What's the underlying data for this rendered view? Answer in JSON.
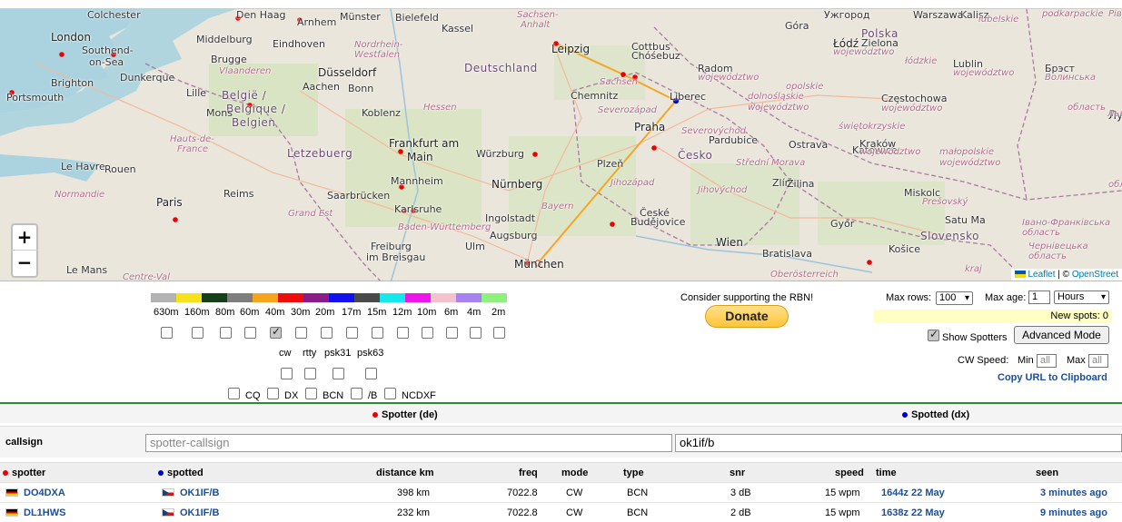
{
  "map": {
    "zoom_in": "+",
    "zoom_out": "−",
    "attribution": {
      "leaflet": "Leaflet",
      "sep": " | © ",
      "osm": "OpenStreet"
    },
    "labels": [
      {
        "t": "Colchester",
        "c": ""
      },
      {
        "t": "London",
        "c": "city-big"
      },
      {
        "t": "Southend-",
        "c": ""
      },
      {
        "t": "on-Sea",
        "c": ""
      },
      {
        "t": "Brighton",
        "c": ""
      },
      {
        "t": "Portsmouth",
        "c": ""
      },
      {
        "t": "Dunkerque",
        "c": ""
      },
      {
        "t": "Middelburg",
        "c": ""
      },
      {
        "t": "Brugge",
        "c": ""
      },
      {
        "t": "Vlaanderen",
        "c": "region"
      },
      {
        "t": "Den Haag",
        "c": ""
      },
      {
        "t": "Arnhem",
        "c": ""
      },
      {
        "t": "Eindhoven",
        "c": ""
      },
      {
        "t": "Münster",
        "c": ""
      },
      {
        "t": "Bielefeld",
        "c": ""
      },
      {
        "t": "Nordrhein-",
        "c": "region"
      },
      {
        "t": "Westfalen",
        "c": "region"
      },
      {
        "t": "Düsseldorf",
        "c": "city-big"
      },
      {
        "t": "Lille",
        "c": ""
      },
      {
        "t": "België /",
        "c": "country"
      },
      {
        "t": "Belgique /",
        "c": "country"
      },
      {
        "t": "Belgien",
        "c": "country"
      },
      {
        "t": "Aachen",
        "c": ""
      },
      {
        "t": "Bonn",
        "c": ""
      },
      {
        "t": "Mons",
        "c": ""
      },
      {
        "t": "Koblenz",
        "c": ""
      },
      {
        "t": "Kassel",
        "c": ""
      },
      {
        "t": "Deutschland",
        "c": "country"
      },
      {
        "t": "Hessen",
        "c": "region"
      },
      {
        "t": "Frankfurt am",
        "c": "city-big"
      },
      {
        "t": "Main",
        "c": "city-big"
      },
      {
        "t": "Hauts-de-",
        "c": "region"
      },
      {
        "t": "France",
        "c": "region"
      },
      {
        "t": "Letzebuerg",
        "c": "country"
      },
      {
        "t": "Le Havre",
        "c": ""
      },
      {
        "t": "Rouen",
        "c": ""
      },
      {
        "t": "Reims",
        "c": ""
      },
      {
        "t": "Normandie",
        "c": "region"
      },
      {
        "t": "Paris",
        "c": "city-big"
      },
      {
        "t": "Saarbrücken",
        "c": ""
      },
      {
        "t": "Mannheim",
        "c": ""
      },
      {
        "t": "Karlsruhe",
        "c": ""
      },
      {
        "t": "Grand Est",
        "c": "region"
      },
      {
        "t": "Baden-Württemberg",
        "c": "region"
      },
      {
        "t": "Würzburg",
        "c": ""
      },
      {
        "t": "Nürnberg",
        "c": "city-big"
      },
      {
        "t": "Ingolstadt",
        "c": ""
      },
      {
        "t": "Bayern",
        "c": "region"
      },
      {
        "t": "Augsburg",
        "c": ""
      },
      {
        "t": "Ulm",
        "c": ""
      },
      {
        "t": "Freiburg",
        "c": ""
      },
      {
        "t": "im Breisgau",
        "c": ""
      },
      {
        "t": "München",
        "c": "city-big"
      },
      {
        "t": "Le Mans",
        "c": ""
      },
      {
        "t": "Centre-Val",
        "c": "region"
      },
      {
        "t": "Leipzig",
        "c": "city-big"
      },
      {
        "t": "Sachsen-",
        "c": "region"
      },
      {
        "t": "Anhalt",
        "c": "region"
      },
      {
        "t": "Sachsen",
        "c": "region"
      },
      {
        "t": "Chemnitz",
        "c": ""
      },
      {
        "t": "Cottbus",
        "c": ""
      },
      {
        "t": "Chóśebuz",
        "c": ""
      },
      {
        "t": "Liberec",
        "c": ""
      },
      {
        "t": "Severozápad",
        "c": "region"
      },
      {
        "t": "Praha",
        "c": "city-big"
      },
      {
        "t": "Severovýchod",
        "c": "region"
      },
      {
        "t": "Plzeň",
        "c": ""
      },
      {
        "t": "Jihozápad",
        "c": "region"
      },
      {
        "t": "České",
        "c": ""
      },
      {
        "t": "Budějovice",
        "c": ""
      },
      {
        "t": "Pardubice",
        "c": ""
      },
      {
        "t": "Česko",
        "c": "country"
      },
      {
        "t": "Jihovýchod",
        "c": "region"
      },
      {
        "t": "Střední Morava",
        "c": "region"
      },
      {
        "t": "Ostrava",
        "c": ""
      },
      {
        "t": "Zlín",
        "c": ""
      },
      {
        "t": "Žilina",
        "c": ""
      },
      {
        "t": "Wien",
        "c": "city-big"
      },
      {
        "t": "Bratislava",
        "c": ""
      },
      {
        "t": "Oberösterreich",
        "c": "region"
      },
      {
        "t": "Győr",
        "c": ""
      },
      {
        "t": "Slovensko",
        "c": "country"
      },
      {
        "t": "Košice",
        "c": ""
      },
      {
        "t": "Miskolc",
        "c": ""
      },
      {
        "t": "Prešovský",
        "c": "region"
      },
      {
        "t": "kraj",
        "c": "region"
      },
      {
        "t": "Satu Ma",
        "c": ""
      },
      {
        "t": "Ужгород",
        "c": ""
      },
      {
        "t": "Polska",
        "c": "country"
      },
      {
        "t": "Zielona",
        "c": ""
      },
      {
        "t": "Góra",
        "c": ""
      },
      {
        "t": "Kalisz",
        "c": ""
      },
      {
        "t": "Łódź",
        "c": "city-big"
      },
      {
        "t": "województwo",
        "c": "region"
      },
      {
        "t": "łódzkie",
        "c": "region"
      },
      {
        "t": "Radom",
        "c": ""
      },
      {
        "t": "województwo",
        "c": "region"
      },
      {
        "t": "dolnośląskie",
        "c": "region"
      },
      {
        "t": "województwo",
        "c": "region"
      },
      {
        "t": "opolskie",
        "c": "region"
      },
      {
        "t": "Częstochowa",
        "c": ""
      },
      {
        "t": "województwo",
        "c": "region"
      },
      {
        "t": "świętokrzyskie",
        "c": "region"
      },
      {
        "t": "Katowice",
        "c": ""
      },
      {
        "t": "Kraków",
        "c": ""
      },
      {
        "t": "województwo",
        "c": "region"
      },
      {
        "t": "małopolskie",
        "c": "region"
      },
      {
        "t": "województwo",
        "c": "region"
      },
      {
        "t": "podkarpackie",
        "c": "region"
      },
      {
        "t": "Lublin",
        "c": ""
      },
      {
        "t": "województwo",
        "c": "region"
      },
      {
        "t": "lubelskie",
        "c": "region"
      },
      {
        "t": "Брэст",
        "c": ""
      },
      {
        "t": "Волинська",
        "c": "region"
      },
      {
        "t": "область",
        "c": "region"
      },
      {
        "t": "Луцьк",
        "c": "city-big"
      },
      {
        "t": "Рівне",
        "c": "region"
      },
      {
        "t": "Львівська",
        "c": "region"
      },
      {
        "t": "область",
        "c": "region"
      },
      {
        "t": "Івано-Франківська",
        "c": "region"
      },
      {
        "t": "область",
        "c": "region"
      },
      {
        "t": "Чернівецька",
        "c": "region"
      },
      {
        "t": "область",
        "c": "region"
      },
      {
        "t": "Warszawa",
        "c": ""
      }
    ]
  },
  "bands": {
    "labels": [
      "630m",
      "160m",
      "80m",
      "60m",
      "40m",
      "30m",
      "20m",
      "17m",
      "15m",
      "12m",
      "10m",
      "6m",
      "4m",
      "2m"
    ],
    "colors": [
      "#b3b3b3",
      "#f7e11b",
      "#16401a",
      "#7e7e7e",
      "#f5a51d",
      "#ee0d0d",
      "#8b1a8b",
      "#1212ee",
      "#4a4a4a",
      "#14e8ec",
      "#ee14ec",
      "#f5c1cd",
      "#a681f0",
      "#8ef07d"
    ],
    "checked_index": 4
  },
  "modes": {
    "labels": [
      "cw",
      "rtty",
      "psk31",
      "psk63"
    ]
  },
  "types": {
    "labels": [
      "CQ",
      "DX",
      "BCN",
      "/B",
      "NCDXF"
    ]
  },
  "support": {
    "text": "Consider supporting the RBN!",
    "donate_label": "Donate"
  },
  "settings": {
    "max_rows_label": "Max rows:",
    "max_rows_value": "100",
    "max_age_label": "Max age:",
    "max_age_value": "1",
    "max_age_unit": "Hours",
    "new_spots": "New spots: 0",
    "show_spotters_label": "Show Spotters",
    "advanced_mode_label": "Advanced Mode",
    "cw_speed_label": "CW Speed:",
    "min_label": "Min",
    "min_placeholder": "all",
    "max_label": "Max",
    "max_placeholder": "all",
    "copy_url_label": "Copy URL to Clipboard"
  },
  "legend": {
    "spotter": "Spotter (de)",
    "spotted": "Spotted (dx)"
  },
  "filters": {
    "callsign_label": "callsign",
    "spotter_placeholder": "spotter-callsign",
    "spotted_value": "ok1if/b"
  },
  "table": {
    "headers": {
      "spotter": "spotter",
      "spotted": "spotted",
      "distance": "distance km",
      "freq": "freq",
      "mode": "mode",
      "type": "type",
      "snr": "snr",
      "speed": "speed",
      "time": "time",
      "seen": "seen"
    },
    "rows": [
      {
        "spotter": "DO4DXA",
        "spotted": "OK1IF/B",
        "distance": "398 km",
        "freq": "7022.8",
        "mode": "CW",
        "type": "BCN",
        "snr": "3 dB",
        "speed": "15 wpm",
        "time": "1644z 22 May",
        "seen": "3 minutes ago"
      },
      {
        "spotter": "DL1HWS",
        "spotted": "OK1IF/B",
        "distance": "232 km",
        "freq": "7022.8",
        "mode": "CW",
        "type": "BCN",
        "snr": "2 dB",
        "speed": "15 wpm",
        "time": "1638z 22 May",
        "seen": "9 minutes ago"
      }
    ]
  }
}
